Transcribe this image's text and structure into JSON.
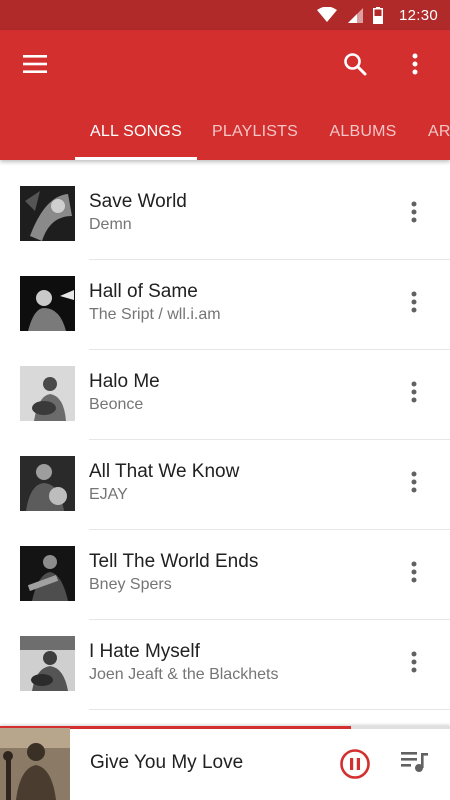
{
  "status_bar": {
    "time": "12:30",
    "icons": [
      "wifi-icon",
      "cell-signal-icon",
      "battery-icon"
    ]
  },
  "toolbar": {
    "menu_icon": "menu-icon",
    "search_icon": "search-icon",
    "overflow_icon": "more-vert-icon"
  },
  "tabs": [
    {
      "label": "ALL SONGS",
      "active": true
    },
    {
      "label": "PLAYLISTS",
      "active": false
    },
    {
      "label": "ALBUMS",
      "active": false
    },
    {
      "label": "ARTISTS",
      "active": false
    }
  ],
  "songs": [
    {
      "title": "Save World",
      "artist": "Demn"
    },
    {
      "title": "Hall of Same",
      "artist": "The Sript / wll.i.am"
    },
    {
      "title": "Halo Me",
      "artist": "Beonce"
    },
    {
      "title": "All That We Know",
      "artist": "EJAY"
    },
    {
      "title": "Tell The World Ends",
      "artist": "Bney Spers"
    },
    {
      "title": "I Hate Myself",
      "artist": "Joen Jeaft & the Blackhets"
    }
  ],
  "now_playing": {
    "title": "Give You My Love",
    "progress": 0.78,
    "pause_icon": "pause-circle-icon",
    "queue_icon": "queue-music-icon"
  },
  "colors": {
    "primary": "#d32f2f",
    "status_bar": "#b02a2a",
    "accent": "#d32f2f"
  }
}
